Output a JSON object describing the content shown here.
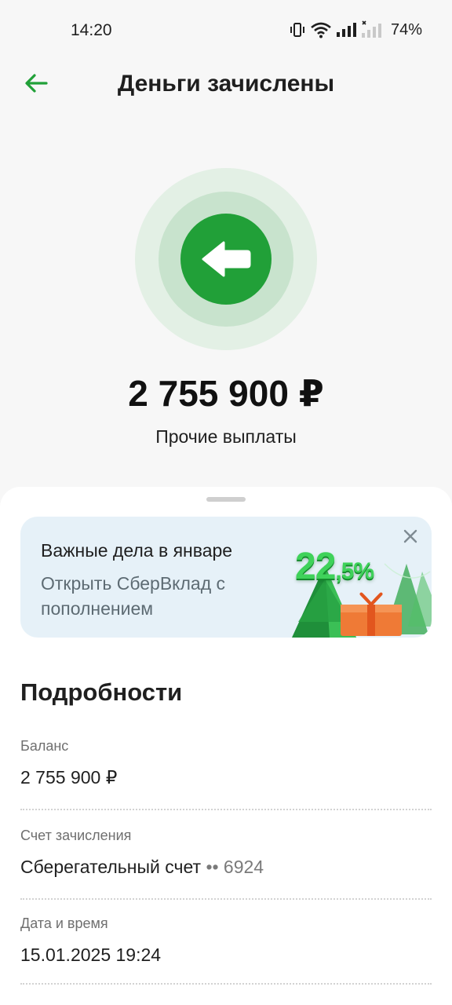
{
  "status_bar": {
    "time": "14:20",
    "battery": "74%"
  },
  "header": {
    "title": "Деньги зачислены",
    "back_icon": "arrow-left-icon"
  },
  "hero": {
    "icon": "incoming-arrow-icon",
    "amount": "2 755 900 ₽",
    "category": "Прочие выплаты"
  },
  "promo": {
    "title": "Важные дела в январе",
    "subtitle": "Открыть СберВклад с пополнением",
    "rate_main": "22",
    "rate_frac": ",5%"
  },
  "details": {
    "title": "Подробности",
    "items": [
      {
        "label": "Баланс",
        "value": "2 755 900 ₽",
        "suffix": ""
      },
      {
        "label": "Счет зачисления",
        "value": "Сберегательный счет",
        "suffix": "•• 6924"
      },
      {
        "label": "Дата и время",
        "value": "15.01.2025 19:24",
        "suffix": ""
      }
    ]
  },
  "colors": {
    "accent": "#21a038",
    "background": "#f7f7f7",
    "promo_bg": "#e6f1f8"
  }
}
